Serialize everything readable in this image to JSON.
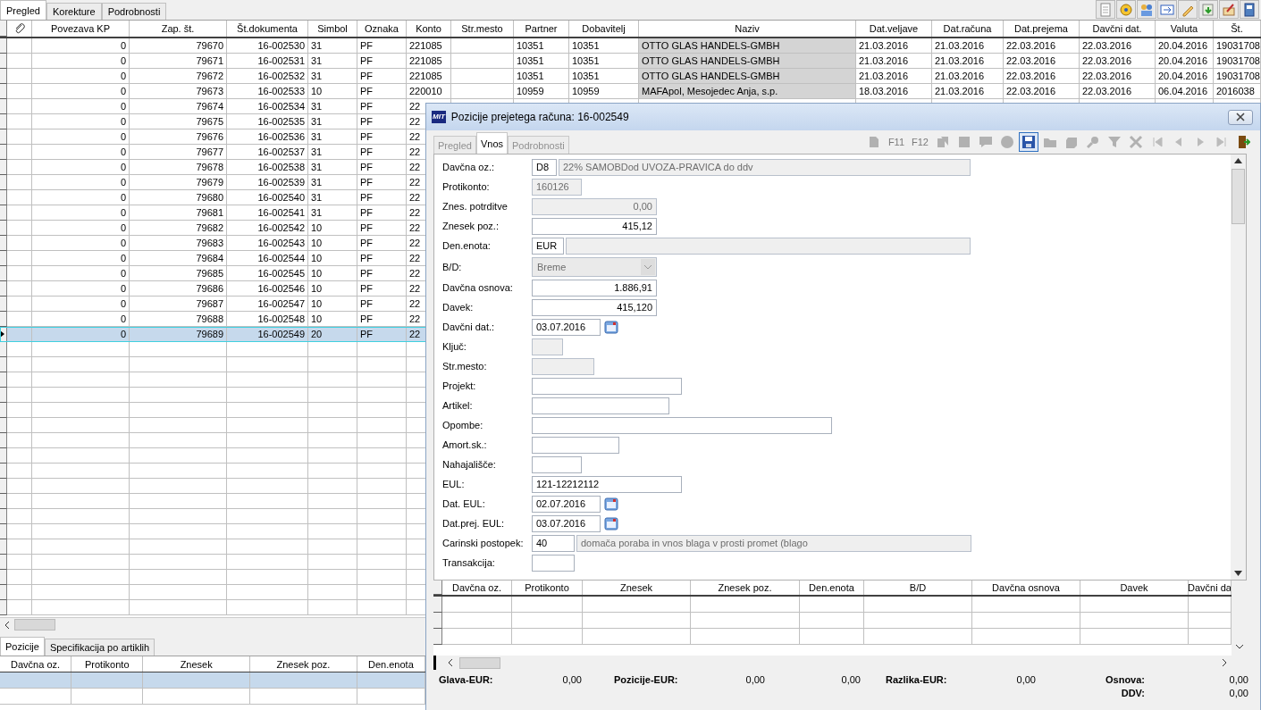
{
  "main_tabs": [
    {
      "label": "Pregled",
      "selected": true
    },
    {
      "label": "Korekture",
      "selected": false
    },
    {
      "label": "Podrobnosti",
      "selected": false
    }
  ],
  "toolbar": [
    {
      "kind": "document"
    },
    {
      "kind": "disc"
    },
    {
      "kind": "users"
    },
    {
      "kind": "refresh"
    },
    {
      "kind": "pencil"
    },
    {
      "kind": "import"
    },
    {
      "kind": "edit"
    },
    {
      "kind": "book"
    }
  ],
  "table": {
    "columns": [
      "Povezava KP",
      "Zap. št.",
      "Št.dokumenta",
      "Simbol",
      "Oznaka",
      "Konto",
      "Str.mesto",
      "Partner",
      "Dobavitelj",
      "Naziv",
      "Dat.veljave",
      "Dat.računa",
      "Dat.prejema",
      "Davčni dat.",
      "Valuta",
      "Št."
    ],
    "rows": [
      {
        "selected": false,
        "cells": [
          "0",
          "79670",
          "16-002530",
          "31",
          "PF",
          "221085",
          "",
          "10351",
          "10351",
          "OTTO GLAS HANDELS-GMBH",
          "21.03.2016",
          "21.03.2016",
          "22.03.2016",
          "22.03.2016",
          "20.04.2016",
          "19031708"
        ]
      },
      {
        "selected": false,
        "cells": [
          "0",
          "79671",
          "16-002531",
          "31",
          "PF",
          "221085",
          "",
          "10351",
          "10351",
          "OTTO GLAS HANDELS-GMBH",
          "21.03.2016",
          "21.03.2016",
          "22.03.2016",
          "22.03.2016",
          "20.04.2016",
          "19031708"
        ]
      },
      {
        "selected": false,
        "cells": [
          "0",
          "79672",
          "16-002532",
          "31",
          "PF",
          "221085",
          "",
          "10351",
          "10351",
          "OTTO GLAS HANDELS-GMBH",
          "21.03.2016",
          "21.03.2016",
          "22.03.2016",
          "22.03.2016",
          "20.04.2016",
          "19031708"
        ]
      },
      {
        "selected": false,
        "cells": [
          "0",
          "79673",
          "16-002533",
          "10",
          "PF",
          "220010",
          "",
          "10959",
          "10959",
          "MAFApol, Mesojedec Anja, s.p.",
          "18.03.2016",
          "21.03.2016",
          "22.03.2016",
          "22.03.2016",
          "06.04.2016",
          "2016038"
        ]
      },
      {
        "selected": false,
        "cells": [
          "0",
          "79674",
          "16-002534",
          "31",
          "PF",
          "22"
        ]
      },
      {
        "selected": false,
        "cells": [
          "0",
          "79675",
          "16-002535",
          "31",
          "PF",
          "22"
        ]
      },
      {
        "selected": false,
        "cells": [
          "0",
          "79676",
          "16-002536",
          "31",
          "PF",
          "22"
        ]
      },
      {
        "selected": false,
        "cells": [
          "0",
          "79677",
          "16-002537",
          "31",
          "PF",
          "22"
        ]
      },
      {
        "selected": false,
        "cells": [
          "0",
          "79678",
          "16-002538",
          "31",
          "PF",
          "22"
        ]
      },
      {
        "selected": false,
        "cells": [
          "0",
          "79679",
          "16-002539",
          "31",
          "PF",
          "22"
        ]
      },
      {
        "selected": false,
        "cells": [
          "0",
          "79680",
          "16-002540",
          "31",
          "PF",
          "22"
        ]
      },
      {
        "selected": false,
        "cells": [
          "0",
          "79681",
          "16-002541",
          "31",
          "PF",
          "22"
        ]
      },
      {
        "selected": false,
        "cells": [
          "0",
          "79682",
          "16-002542",
          "10",
          "PF",
          "22"
        ]
      },
      {
        "selected": false,
        "cells": [
          "0",
          "79683",
          "16-002543",
          "10",
          "PF",
          "22"
        ]
      },
      {
        "selected": false,
        "cells": [
          "0",
          "79684",
          "16-002544",
          "10",
          "PF",
          "22"
        ]
      },
      {
        "selected": false,
        "cells": [
          "0",
          "79685",
          "16-002545",
          "10",
          "PF",
          "22"
        ]
      },
      {
        "selected": false,
        "cells": [
          "0",
          "79686",
          "16-002546",
          "10",
          "PF",
          "22"
        ]
      },
      {
        "selected": false,
        "cells": [
          "0",
          "79687",
          "16-002547",
          "10",
          "PF",
          "22"
        ]
      },
      {
        "selected": false,
        "cells": [
          "0",
          "79688",
          "16-002548",
          "10",
          "PF",
          "22"
        ]
      },
      {
        "selected": true,
        "cells": [
          "0",
          "79689",
          "16-002549",
          "20",
          "PF",
          "22"
        ]
      }
    ]
  },
  "detail_tabs": [
    {
      "label": "Pozicije",
      "selected": true
    },
    {
      "label": "Specifikacija po artiklih",
      "selected": false
    }
  ],
  "detail_table": {
    "columns": [
      "Davčna oz.",
      "Protikonto",
      "Znesek",
      "Znesek poz.",
      "Den.enota"
    ],
    "rows": [
      {
        "selected": true
      },
      {
        "selected": false
      }
    ]
  },
  "dialog": {
    "logo": "MIT",
    "title": "Pozicije prejetega računa: 16-002549",
    "tabs": [
      {
        "label": "Pregled",
        "selected": false,
        "disabled": true
      },
      {
        "label": "Vnos",
        "selected": true,
        "disabled": false
      },
      {
        "label": "Podrobnosti",
        "selected": false,
        "disabled": true
      }
    ],
    "toolbar": [
      {
        "kind": "new",
        "disabled": true
      },
      {
        "kind": "key",
        "text": "F11",
        "disabled": true
      },
      {
        "kind": "key",
        "text": "F12",
        "disabled": true
      },
      {
        "kind": "copy",
        "disabled": true
      },
      {
        "kind": "square",
        "disabled": true
      },
      {
        "kind": "chat",
        "disabled": true
      },
      {
        "kind": "circle",
        "disabled": true
      },
      {
        "kind": "save",
        "disabled": false
      },
      {
        "kind": "folder",
        "disabled": true
      },
      {
        "kind": "shape",
        "disabled": true
      },
      {
        "kind": "search",
        "disabled": true
      },
      {
        "kind": "filter",
        "disabled": true
      },
      {
        "kind": "delete",
        "disabled": true
      },
      {
        "kind": "first",
        "disabled": true
      },
      {
        "kind": "prev",
        "disabled": true
      },
      {
        "kind": "next",
        "disabled": true
      },
      {
        "kind": "last",
        "disabled": true
      },
      {
        "kind": "exit",
        "disabled": false
      }
    ],
    "fields": [
      {
        "label": "Davčna oz.:",
        "kind": "code",
        "value": "D8",
        "readonly": false,
        "description": "22% SAMOBDod UVOZA-PRAVICA do ddv"
      },
      {
        "label": "Protikonto:",
        "kind": "text",
        "value": "160126",
        "readonly": true
      },
      {
        "label": "Znes. potrditve",
        "kind": "amount",
        "value": "0,00",
        "readonly": true
      },
      {
        "label": "Znesek poz.:",
        "kind": "amount",
        "value": "415,12",
        "readonly": false
      },
      {
        "label": "Den.enota:",
        "kind": "code",
        "value": "EUR",
        "readonly": false
      },
      {
        "label": "B/D:",
        "kind": "combo",
        "value": "Breme",
        "readonly": true
      },
      {
        "label": "Davčna osnova:",
        "kind": "amount",
        "value": "1.886,91",
        "readonly": false
      },
      {
        "label": "Davek:",
        "kind": "amount",
        "value": "415,120",
        "readonly": false
      },
      {
        "label": "Davčni dat.:",
        "kind": "date",
        "value": "03.07.2016",
        "readonly": false
      },
      {
        "label": "Ključ:",
        "kind": "text",
        "readonly": true
      },
      {
        "label": "Str.mesto:",
        "kind": "text",
        "readonly": true
      },
      {
        "label": "Projekt:",
        "kind": "text",
        "readonly": false
      },
      {
        "label": "Artikel:",
        "kind": "text",
        "readonly": false
      },
      {
        "label": "Opombe:",
        "kind": "text",
        "readonly": false
      },
      {
        "label": "Amort.sk.:",
        "kind": "text",
        "readonly": false
      },
      {
        "label": "Nahajališče:",
        "kind": "text",
        "readonly": false
      },
      {
        "label": "EUL:",
        "kind": "text",
        "value": "121-12212112",
        "readonly": false
      },
      {
        "label": "Dat. EUL:",
        "kind": "date",
        "value": "02.07.2016",
        "readonly": false
      },
      {
        "label": "Dat.prej. EUL:",
        "kind": "date",
        "value": "03.07.2016",
        "readonly": false
      },
      {
        "label": "Carinski postopek:",
        "kind": "code",
        "value": "40",
        "readonly": false,
        "description": "domača poraba in vnos blaga v prosti promet (blago"
      },
      {
        "label": "Transakcija:",
        "kind": "text",
        "readonly": false
      }
    ],
    "grid_columns": [
      "Davčna oz.",
      "Protikonto",
      "Znesek",
      "Znesek poz.",
      "Den.enota",
      "B/D",
      "Davčna osnova",
      "Davek",
      "Davčni da"
    ],
    "totals": [
      {
        "label": "Glava-EUR:",
        "values": [
          "0,00"
        ]
      },
      {
        "label": "Pozicije-EUR:",
        "values": [
          "0,00",
          "0,00"
        ]
      },
      {
        "label": "Razlika-EUR:",
        "values": [
          "0,00"
        ]
      },
      {
        "label": "Osnova:",
        "values": [
          "0,00"
        ]
      },
      {
        "label": "DDV:",
        "values": [
          "0,00"
        ]
      }
    ]
  }
}
